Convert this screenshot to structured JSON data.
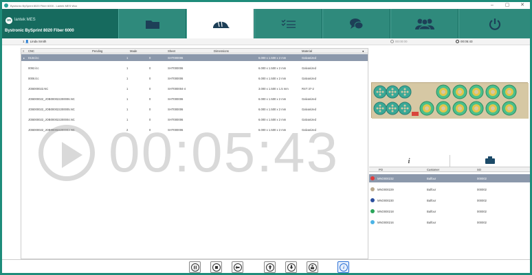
{
  "window": {
    "title": "Bystronic BySprint 8020 Fiber 6000 - Lantek MES Wox",
    "controls": [
      "–",
      "▢",
      "✕"
    ]
  },
  "brand": {
    "logo_mark": "im",
    "logo_text": "lantek MES",
    "machine_name": "Bystronic BySprint 8020 Fiber 6000"
  },
  "nav_tabs": [
    {
      "icon": "folder-icon"
    },
    {
      "icon": "hardhat-icon"
    },
    {
      "icon": "checklist-icon"
    },
    {
      "icon": "chat-icon"
    },
    {
      "icon": "users-icon"
    },
    {
      "icon": "power-icon"
    }
  ],
  "userbar": {
    "user_index": "1",
    "user_name": "Linda Smith",
    "timer_idle": "00:00:00",
    "timer_run": "00:05:43"
  },
  "grid": {
    "columns": [
      "CNC",
      "Pending",
      "Made",
      "Sheet",
      "Dimensions",
      "Material"
    ],
    "rows": [
      {
        "cnc": "0134.lcc",
        "pending": "",
        "made": "1",
        "sheet_qty": "0",
        "sheet": "SHT000006",
        "dim": "6.000 x 1.500 x 2 mm",
        "material": "Galvanized"
      },
      {
        "cnc": "0092.lcc",
        "pending": "",
        "made": "1",
        "sheet_qty": "0",
        "sheet": "SHT000006",
        "dim": "6.000 x 1.500 x 2 mm",
        "material": "Galvanized"
      },
      {
        "cnc": "0006.lcc",
        "pending": "",
        "made": "1",
        "sheet_qty": "0",
        "sheet": "SHT000006",
        "dim": "6.000 x 1.500 x 2 mm",
        "material": "Galvanized"
      },
      {
        "cnc": "JOB000022.NC",
        "pending": "",
        "made": "1",
        "sheet_qty": "0",
        "sheet": "SHT000004-4",
        "dim": "3.000 x 1.500 x 1.5 mm",
        "material": "RST 37-2"
      },
      {
        "cnc": "JOB000022_JOB000022200006.NC",
        "pending": "",
        "made": "1",
        "sheet_qty": "0",
        "sheet": "SHT000006",
        "dim": "6.000 x 1.500 x 2 mm",
        "material": "Galvanized"
      },
      {
        "cnc": "JOB000022_JOB000022200005.NC",
        "pending": "",
        "made": "1",
        "sheet_qty": "0",
        "sheet": "SHT000006",
        "dim": "6.000 x 1.500 x 2 mm",
        "material": "Galvanized"
      },
      {
        "cnc": "JOB000022_JOB000022200004.NC",
        "pending": "",
        "made": "1",
        "sheet_qty": "0",
        "sheet": "SHT000006",
        "dim": "6.000 x 1.500 x 2 mm",
        "material": "Galvanized"
      },
      {
        "cnc": "JOB000022_JOB000022200003.NC",
        "pending": "",
        "made": "2",
        "sheet_qty": "0",
        "sheet": "SHT000006",
        "dim": "6.000 x 1.500 x 2 mm",
        "material": "Galvanized"
      }
    ]
  },
  "big_timer": "00:05:43",
  "panel_tabs": {
    "info_label": "i"
  },
  "orders": {
    "columns": [
      "PO",
      "Customer",
      "SO"
    ],
    "rows": [
      {
        "po": "MNO000232",
        "customer": "Balfour",
        "so": "000002",
        "color": "#e23a3a"
      },
      {
        "po": "MNO000229",
        "customer": "Balfour",
        "so": "000002",
        "color": "#b9a98e"
      },
      {
        "po": "MNO000230",
        "customer": "Balfour",
        "so": "000002",
        "color": "#2b4f9e"
      },
      {
        "po": "MNO000218",
        "customer": "Balfour",
        "so": "000002",
        "color": "#2aa55a"
      },
      {
        "po": "MNO000216",
        "customer": "Balfour",
        "so": "000002",
        "color": "#4bb3e6"
      }
    ]
  },
  "bottom_buttons": [
    {
      "icon": "pause-icon"
    },
    {
      "icon": "stop-icon"
    },
    {
      "icon": "back-icon"
    },
    {
      "icon": "arrow-up-icon"
    },
    {
      "icon": "arrow-down-icon"
    },
    {
      "icon": "unload-icon"
    },
    {
      "icon": "info-icon"
    }
  ],
  "colors": {
    "accent": "#166a5e",
    "nav_tab": "#2f8a7c",
    "selected_row": "#8b98ab",
    "highlight_button": "#2a6fd6"
  }
}
